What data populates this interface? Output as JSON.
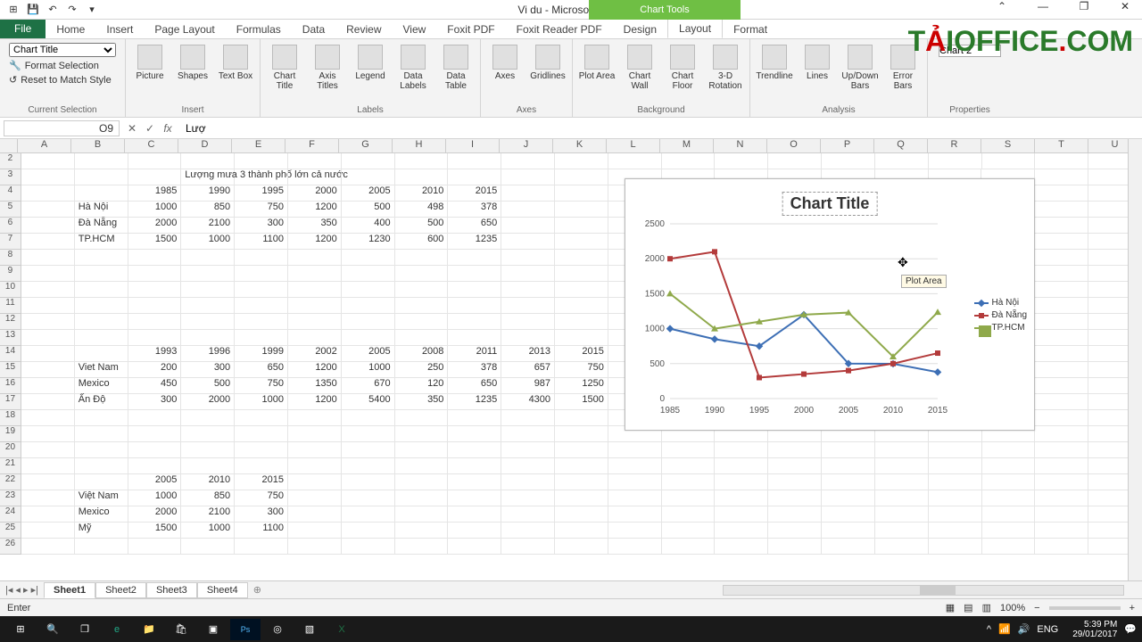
{
  "title": "Vi du - Microsoft Excel",
  "chart_tools_label": "Chart Tools",
  "brand": {
    "t": "T",
    "a": "Ả",
    "rest": "IOFFICE",
    "dot": ".",
    "com": "COM"
  },
  "win": {
    "min": "—",
    "max": "❐",
    "close": "✕",
    "help": "?",
    "up": "^"
  },
  "tabs": [
    "File",
    "Home",
    "Insert",
    "Page Layout",
    "Formulas",
    "Data",
    "Review",
    "View",
    "Foxit PDF",
    "Foxit Reader PDF",
    "Design",
    "Layout",
    "Format"
  ],
  "ribbon": {
    "selection": {
      "value": "Chart Title",
      "fmt": "Format Selection",
      "reset": "Reset to Match Style",
      "label": "Current Selection"
    },
    "insert": {
      "btns": [
        "Picture",
        "Shapes",
        "Text Box"
      ],
      "label": "Insert"
    },
    "labels": {
      "btns": [
        "Chart Title",
        "Axis Titles",
        "Legend",
        "Data Labels",
        "Data Table"
      ],
      "label": "Labels"
    },
    "axes": {
      "btns": [
        "Axes",
        "Gridlines"
      ],
      "label": "Axes"
    },
    "bg": {
      "btns": [
        "Plot Area",
        "Chart Wall",
        "Chart Floor",
        "3-D Rotation"
      ],
      "label": "Background"
    },
    "analysis": {
      "btns": [
        "Trendline",
        "Lines",
        "Up/Down Bars",
        "Error Bars"
      ],
      "label": "Analysis"
    },
    "props": {
      "name": "Chart 2",
      "label": "Properties"
    }
  },
  "namebox": "O9",
  "formula": "Lượ",
  "colheads": [
    "A",
    "B",
    "C",
    "D",
    "E",
    "F",
    "G",
    "H",
    "I",
    "J",
    "K",
    "L",
    "M",
    "N",
    "O",
    "P",
    "Q",
    "R",
    "S",
    "T",
    "U"
  ],
  "sheet": {
    "title": "Lượng mưa 3 thành phố lớn cả nước",
    "hdr1": [
      "1985",
      "1990",
      "1995",
      "2000",
      "2005",
      "2010",
      "2015"
    ],
    "rows1": [
      {
        "l": "Hà Nội",
        "v": [
          "1000",
          "850",
          "750",
          "1200",
          "500",
          "498",
          "378"
        ]
      },
      {
        "l": "Đà Nẵng",
        "v": [
          "2000",
          "2100",
          "300",
          "350",
          "400",
          "500",
          "650"
        ]
      },
      {
        "l": "TP.HCM",
        "v": [
          "1500",
          "1000",
          "1100",
          "1200",
          "1230",
          "600",
          "1235"
        ]
      }
    ],
    "hdr2": [
      "1993",
      "1996",
      "1999",
      "2002",
      "2005",
      "2008",
      "2011",
      "2013",
      "2015"
    ],
    "rows2": [
      {
        "l": "Viet Nam",
        "v": [
          "200",
          "300",
          "650",
          "1200",
          "1000",
          "250",
          "378",
          "657",
          "750"
        ]
      },
      {
        "l": "Mexico",
        "v": [
          "450",
          "500",
          "750",
          "1350",
          "670",
          "120",
          "650",
          "987",
          "1250"
        ]
      },
      {
        "l": "Ấn Độ",
        "v": [
          "300",
          "2000",
          "1000",
          "1200",
          "5400",
          "350",
          "1235",
          "4300",
          "1500"
        ]
      }
    ],
    "hdr3": [
      "2005",
      "2010",
      "2015"
    ],
    "rows3": [
      {
        "l": "Việt Nam",
        "v": [
          "1000",
          "850",
          "750"
        ]
      },
      {
        "l": "Mexico",
        "v": [
          "2000",
          "2100",
          "300"
        ]
      },
      {
        "l": "Mỹ",
        "v": [
          "1500",
          "1000",
          "1100"
        ]
      }
    ]
  },
  "chart_title": "Chart Title",
  "tooltip": "Plot Area",
  "chart_data": {
    "type": "line",
    "title": "Chart Title",
    "categories": [
      "1985",
      "1990",
      "1995",
      "2000",
      "2005",
      "2010",
      "2015"
    ],
    "ylim": [
      0,
      2500
    ],
    "yticks": [
      0,
      500,
      1000,
      1500,
      2000,
      2500
    ],
    "series": [
      {
        "name": "Hà Nội",
        "color": "#3d6fb5",
        "values": [
          1000,
          850,
          750,
          1200,
          500,
          498,
          378
        ]
      },
      {
        "name": "Đà Nẵng",
        "color": "#b33b3b",
        "values": [
          2000,
          2100,
          300,
          350,
          400,
          500,
          650
        ]
      },
      {
        "name": "TP.HCM",
        "color": "#8fa94b",
        "values": [
          1500,
          1000,
          1100,
          1200,
          1230,
          600,
          1235
        ]
      }
    ]
  },
  "sheettabs": [
    "Sheet1",
    "Sheet2",
    "Sheet3",
    "Sheet4"
  ],
  "status": {
    "mode": "Enter",
    "zoom": "100%"
  },
  "taskbar": {
    "lang": "ENG",
    "time": "5:39 PM",
    "date": "29/01/2017"
  }
}
